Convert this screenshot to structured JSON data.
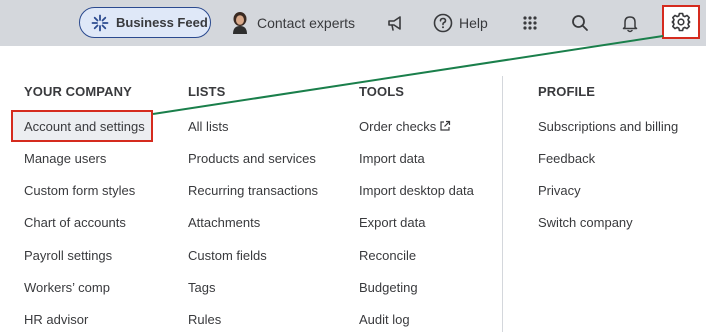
{
  "topbar": {
    "business_feed_label": "Business Feed",
    "contact_label": "Contact experts",
    "help_label": "Help",
    "icons": [
      "sparkle-icon",
      "avatar",
      "megaphone-icon",
      "help-icon",
      "apps-grid-icon",
      "search-icon",
      "bell-icon",
      "gear-icon"
    ]
  },
  "menu": {
    "your_company": {
      "title": "YOUR COMPANY",
      "items": [
        "Account and settings",
        "Manage users",
        "Custom form styles",
        "Chart of accounts",
        "Payroll settings",
        "Workers’ comp",
        "HR advisor"
      ]
    },
    "lists": {
      "title": "LISTS",
      "items": [
        "All lists",
        "Products and services",
        "Recurring transactions",
        "Attachments",
        "Custom fields",
        "Tags",
        "Rules"
      ]
    },
    "tools": {
      "title": "TOOLS",
      "items": [
        "Order checks",
        "Import data",
        "Import desktop data",
        "Export data",
        "Reconcile",
        "Budgeting",
        "Audit log"
      ]
    },
    "profile": {
      "title": "PROFILE",
      "items": [
        "Subscriptions and billing",
        "Feedback",
        "Privacy",
        "Switch company"
      ]
    }
  },
  "colors": {
    "highlight_border": "#d52b1e",
    "connector_line": "#1a7f4b",
    "topbar_bg": "#d4d7dc",
    "pill_border": "#2b4a8f"
  }
}
